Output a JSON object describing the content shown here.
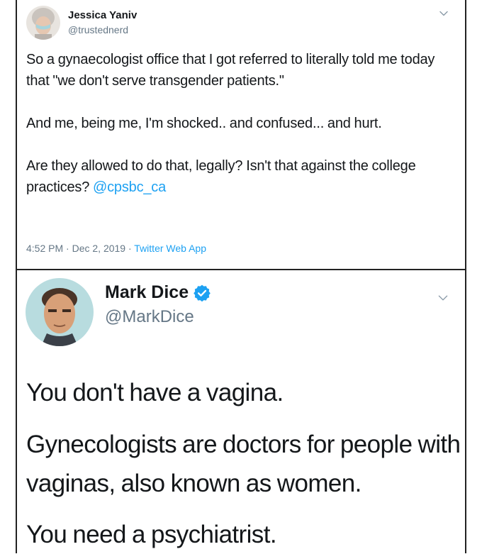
{
  "tweets": [
    {
      "display_name": "Jessica Yaniv",
      "handle": "@trustednerd",
      "paragraphs": [
        "So a gynaecologist office that I got referred to literally told me today that \"we don't serve transgender patients.\"",
        "And me, being me, I'm shocked.. and confused... and hurt.",
        "Are they allowed to do that, legally? Isn't that against the college practices?"
      ],
      "mention": "@cpsbc_ca",
      "time": "4:52 PM",
      "date": "Dec 2, 2019",
      "source": "Twitter Web App",
      "separator": "·"
    },
    {
      "display_name": "Mark Dice",
      "handle": "@MarkDice",
      "verified": true,
      "paragraphs": [
        "You don't have a vagina.",
        "Gynecologists are doctors for people with vaginas, also known as women.",
        "You need a psychiatrist."
      ]
    }
  ],
  "colors": {
    "link": "#1da1f2",
    "muted": "#657786",
    "text": "#14171a",
    "verified": "#1da1f2"
  },
  "icons": {
    "menu": "chevron-down-icon",
    "verified": "verified-badge-icon"
  }
}
